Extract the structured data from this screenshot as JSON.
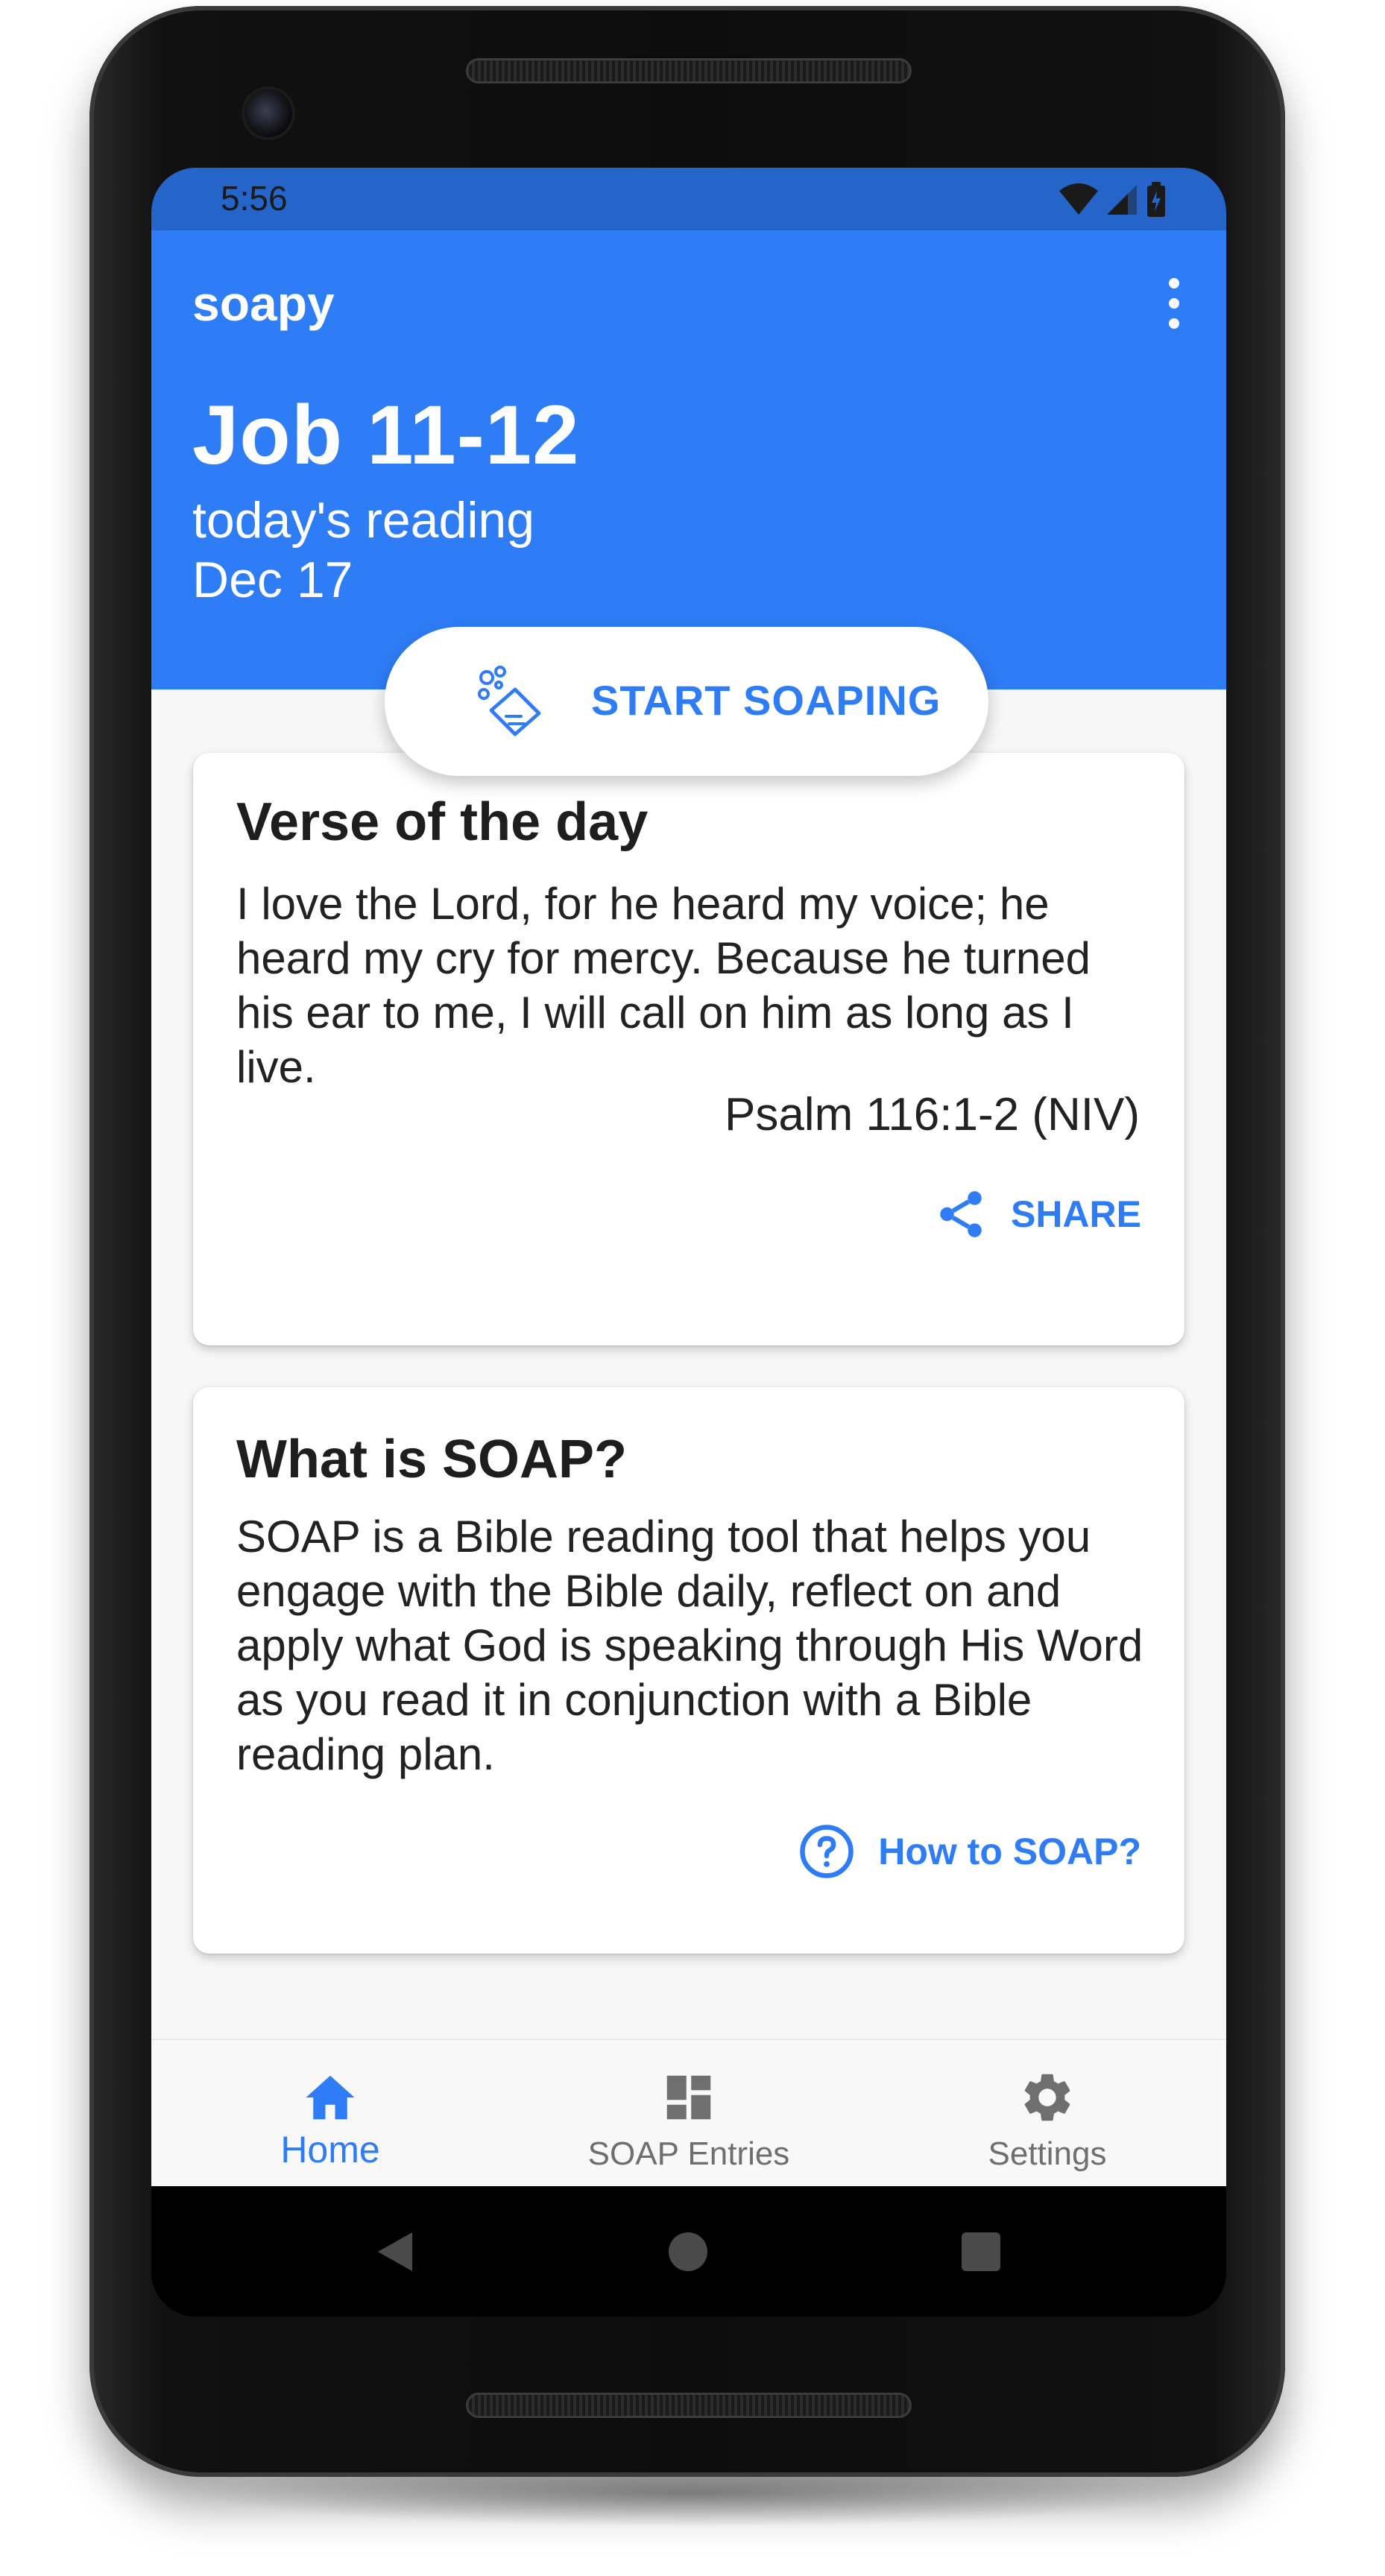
{
  "status_bar": {
    "time": "5:56"
  },
  "app_bar": {
    "title": "soapy",
    "menu_icon": "more-vert-icon"
  },
  "reading": {
    "title": "Job 11-12",
    "subtitle": "today's reading",
    "date": "Dec 17"
  },
  "start_button": {
    "label": "START SOAPING",
    "icon": "soap-icon"
  },
  "verse_card": {
    "heading": "Verse of the day",
    "text": "I love the Lord, for he heard my voice; he heard my cry for mercy. Because he turned his ear to me, I will call on him as long as I live.",
    "reference": "Psalm 116:1-2 (NIV)",
    "action_label": "SHARE",
    "action_icon": "share-icon"
  },
  "soap_card": {
    "heading": "What is SOAP?",
    "text": "SOAP is a Bible reading tool that helps you engage with the Bible daily, reflect on and apply what God is speaking through His Word as you read it in conjunction with a Bible reading plan.",
    "action_label": "How to SOAP?",
    "action_icon": "help-circle-icon"
  },
  "bottom_nav": {
    "items": [
      {
        "label": "Home",
        "icon": "home-icon",
        "active": true
      },
      {
        "label": "SOAP Entries",
        "icon": "dashboard-icon",
        "active": false
      },
      {
        "label": "Settings",
        "icon": "gear-icon",
        "active": false
      }
    ]
  },
  "colors": {
    "primary": "#2e7cf6",
    "status_bar": "#2565c9",
    "background": "#f7f7f7",
    "nav_inactive": "#6f6f6f"
  }
}
